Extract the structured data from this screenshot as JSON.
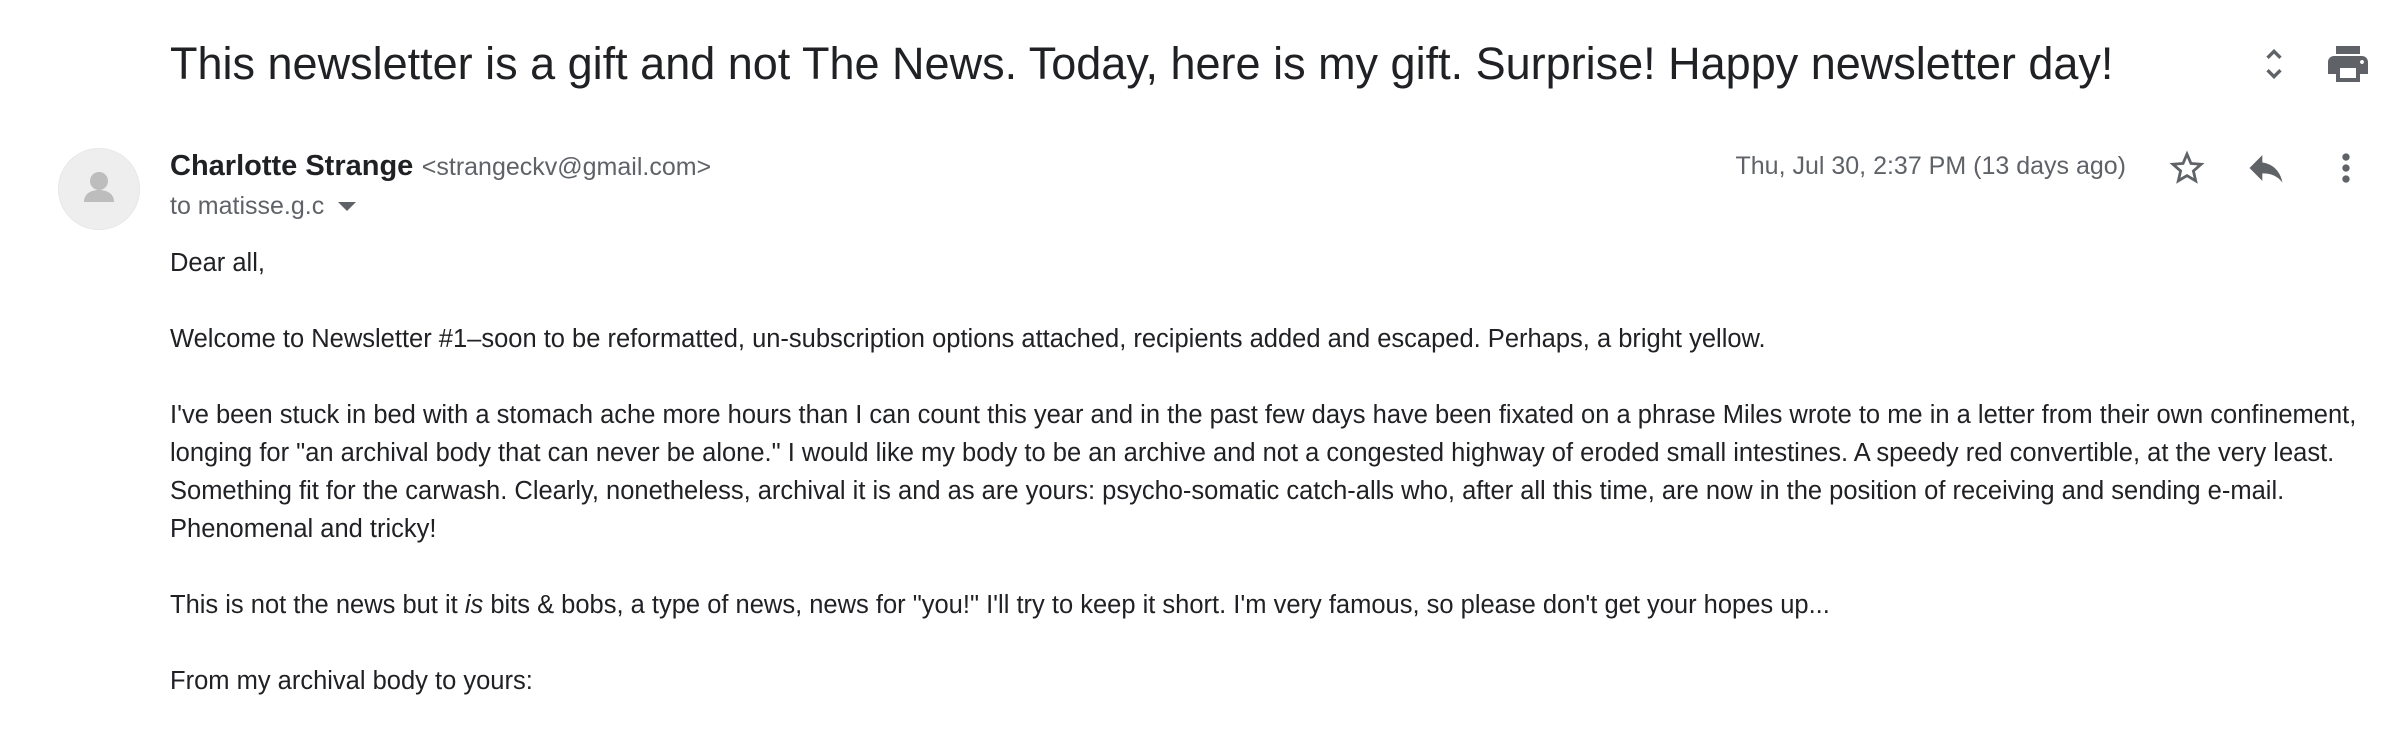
{
  "email": {
    "subject": "This newsletter is a gift and not The News. Today, here is my gift. Surprise! Happy newsletter day!",
    "sender_name": "Charlotte Strange",
    "sender_email": "<strangeckv@gmail.com>",
    "recipient": "to matisse.g.c",
    "date": "Thu, Jul 30, 2:37 PM (13 days ago)",
    "body": {
      "greeting": "Dear all,",
      "p1": "Welcome to Newsletter #1–soon to be reformatted, un-subscription options attached, recipients added and escaped. Perhaps, a bright yellow.",
      "p2": "I've been stuck in bed with a stomach ache more hours than I can count this year and in the past few days have been fixated on a phrase Miles wrote to me in a letter from their own confinement, longing for \"an archival body that can never be alone.\" I would like my body to be an archive and not a congested highway of eroded small intestines. A speedy red convertible, at the very least. Something fit for the carwash. Clearly, nonetheless, archival it is and as are yours: psycho-somatic catch-alls who, after all this time, are now in the position of receiving and sending e-mail. Phenomenal and tricky!",
      "p3_before": "This is not the news but it ",
      "p3_em": "is",
      "p3_after": " bits & bobs, a type of news, news for \"you!\" I'll try to keep it short. I'm very famous, so please don't get your hopes up...",
      "p4": "From my archival body to yours:"
    }
  },
  "icons": {
    "expand": "unfold-icon",
    "print": "print-icon",
    "avatar": "default-avatar-icon",
    "star": "star-icon",
    "reply": "reply-icon",
    "more": "more-vert-icon",
    "recipient_dropdown": "caret-down-icon"
  },
  "colors": {
    "icon": "#5f6368",
    "text": "#202124",
    "avatar_bg": "#eeeeee",
    "avatar_fg": "#bdbdbd"
  }
}
